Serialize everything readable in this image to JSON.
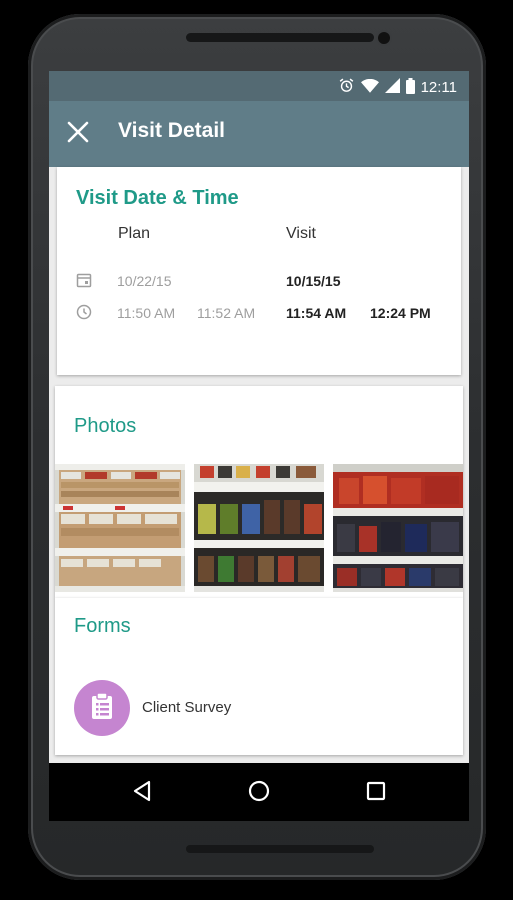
{
  "status_bar": {
    "time": "12:11"
  },
  "app_bar": {
    "title": "Visit Detail"
  },
  "visit": {
    "section_title": "Visit Date & Time",
    "plan_label": "Plan",
    "visit_label": "Visit",
    "plan_date": "10/22/15",
    "visit_date": "10/15/15",
    "plan_start": "11:50 AM",
    "plan_end": "11:52 AM",
    "visit_start": "11:54 AM",
    "visit_end": "12:24 PM"
  },
  "photos": {
    "section_title": "Photos",
    "items": [
      "photo-1",
      "photo-2",
      "photo-3"
    ]
  },
  "forms": {
    "section_title": "Forms",
    "items": [
      {
        "label": "Client Survey",
        "icon": "clipboard-icon"
      }
    ]
  },
  "colors": {
    "accent": "#1f9a88",
    "app_bar": "#607d88",
    "status_bar": "#546a73",
    "form_icon_bg": "#c585d0"
  }
}
